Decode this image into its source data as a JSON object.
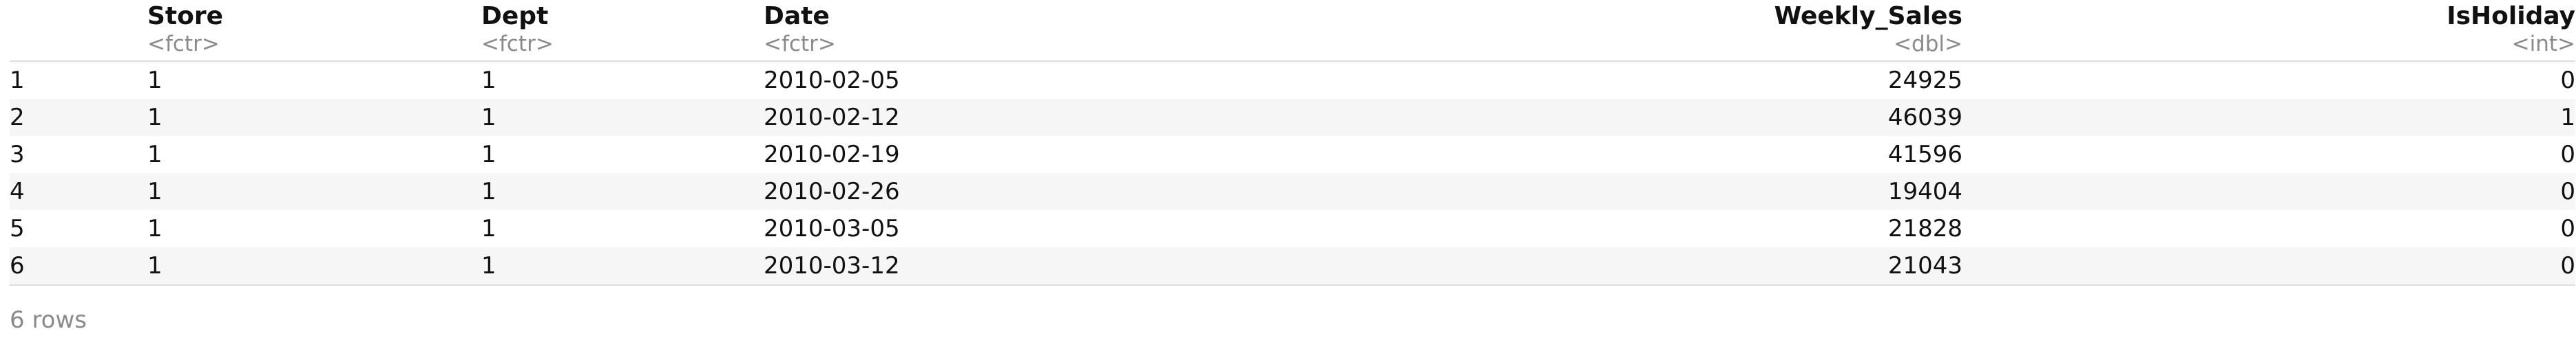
{
  "table": {
    "columns": [
      {
        "name": "Store",
        "type": "<fctr>"
      },
      {
        "name": "Dept",
        "type": "<fctr>"
      },
      {
        "name": "Date",
        "type": "<fctr>"
      },
      {
        "name": "Weekly_Sales",
        "type": "<dbl>"
      },
      {
        "name": "IsHoliday",
        "type": "<int>"
      }
    ],
    "rows": [
      {
        "index": "1",
        "cells": [
          "1",
          "1",
          "2010-02-05",
          "24925",
          "0"
        ]
      },
      {
        "index": "2",
        "cells": [
          "1",
          "1",
          "2010-02-12",
          "46039",
          "1"
        ]
      },
      {
        "index": "3",
        "cells": [
          "1",
          "1",
          "2010-02-19",
          "41596",
          "0"
        ]
      },
      {
        "index": "4",
        "cells": [
          "1",
          "1",
          "2010-02-26",
          "19404",
          "0"
        ]
      },
      {
        "index": "5",
        "cells": [
          "1",
          "1",
          "2010-03-05",
          "21828",
          "0"
        ]
      },
      {
        "index": "6",
        "cells": [
          "1",
          "1",
          "2010-03-12",
          "21043",
          "0"
        ]
      }
    ]
  },
  "footer": {
    "row_count": "6 rows"
  }
}
